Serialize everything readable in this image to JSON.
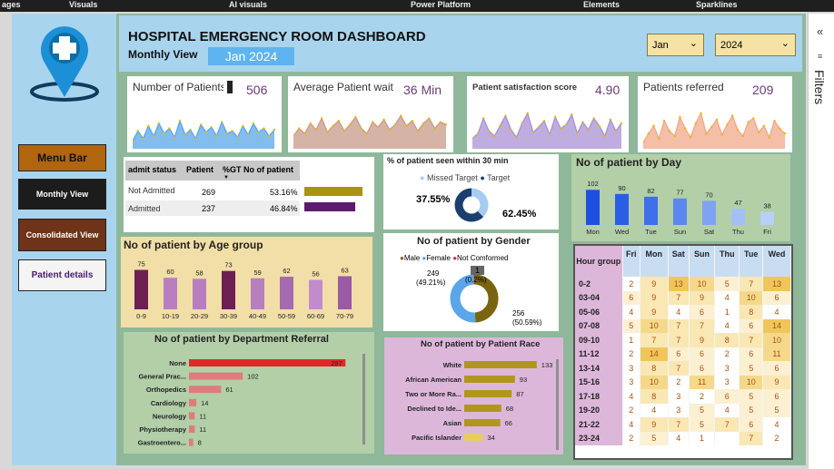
{
  "ribbon": {
    "items": [
      "ages",
      "Visuals",
      "AI visuals",
      "Power Platform",
      "Elements",
      "Sparklines"
    ]
  },
  "header": {
    "title": "HOSPITAL EMERGENCY ROOM DASHBOARD",
    "subtitle": "Monthly View",
    "period": "Jan 2024",
    "month_select": "Jan",
    "year_select": "2024"
  },
  "menu": {
    "title": "Menu Bar",
    "monthly": "Monthly View",
    "consolidated": "Consolidated View",
    "details": "Patient details"
  },
  "kpis": [
    {
      "label": "Number of Patients",
      "value": "506",
      "color": "#5aa6e8"
    },
    {
      "label": "Average Patient wait",
      "value": "36 Min",
      "color": "#c89a8a"
    },
    {
      "label": "Patient satisfaction score",
      "value": "4.90",
      "color": "#a891d3"
    },
    {
      "label": "Patients referred",
      "value": "209",
      "color": "#f0a88a"
    }
  ],
  "admit": {
    "headers": [
      "admit status",
      "Patient",
      "%GT No of patient"
    ],
    "rows": [
      {
        "status": "Not Admitted",
        "patients": "269",
        "pct": "53.16%",
        "share": 0.5316,
        "color": "#a89313"
      },
      {
        "status": "Admitted",
        "patients": "237",
        "pct": "46.84%",
        "share": 0.4684,
        "color": "#5c1b6e"
      }
    ]
  },
  "seen30": {
    "title": "% of patient seen within 30 min",
    "legend": [
      "Missed Target",
      "Target"
    ],
    "missed": "37.55%",
    "target": "62.45%",
    "missed_share": 0.3755,
    "colors": [
      "#a6cdf0",
      "#1a3e6e"
    ]
  },
  "gender": {
    "title": "No of patient by Gender",
    "legend": [
      "Male",
      "Female",
      "Not Comformed"
    ],
    "colors": [
      "#7a6410",
      "#5aa6e8",
      "#e0245e"
    ],
    "male_label": "249",
    "male_pct": "(49.21%)",
    "female_label": "256",
    "female_pct": "(50.59%)",
    "nc_label": "1",
    "nc_pct": "(0.2%)",
    "male_share": 0.4921
  },
  "day_chart": {
    "title": "No of patient by Day",
    "categories": [
      "Mon",
      "Wed",
      "Tue",
      "Sun",
      "Sat",
      "Thu",
      "Fri"
    ],
    "values": [
      102,
      90,
      82,
      77,
      70,
      47,
      38
    ],
    "colors": [
      "#1f4fe0",
      "#2a5ee6",
      "#3d70ea",
      "#5b88ee",
      "#7ea3f2",
      "#a3c0f6",
      "#b8d0f8"
    ]
  },
  "age_chart": {
    "title": "No of patient by Age group",
    "categories": [
      "0-9",
      "10-19",
      "20-29",
      "30-39",
      "40-49",
      "50-59",
      "60-69",
      "70-79"
    ],
    "values": [
      75,
      60,
      58,
      73,
      59,
      62,
      56,
      63
    ],
    "colors": [
      "#6e1f52",
      "#b87fc0",
      "#b87fc0",
      "#6e1f52",
      "#b87fc0",
      "#a56bb0",
      "#c28ccc",
      "#9a5aa6"
    ]
  },
  "dept_chart": {
    "title": "No of patient by Department Referral",
    "categories": [
      "None",
      "General Prac...",
      "Orthopedics",
      "Cardiology",
      "Neurology",
      "Physiotherapy",
      "Gastroentero..."
    ],
    "values": [
      297,
      102,
      61,
      14,
      11,
      11,
      8
    ]
  },
  "race_chart": {
    "title": "No of patient by Patient Race",
    "categories": [
      "White",
      "African American",
      "Two or More Ra...",
      "Declined to Ide...",
      "Asian",
      "Pacific Islander"
    ],
    "values": [
      133,
      93,
      87,
      68,
      66,
      34
    ]
  },
  "hour_grid": {
    "corner": "Hour group",
    "days": [
      "Fri",
      "Mon",
      "Sat",
      "Sun",
      "Thu",
      "Tue",
      "Wed"
    ],
    "rows": [
      {
        "hour": "0-2",
        "vals": [
          2,
          9,
          13,
          10,
          5,
          7,
          13
        ]
      },
      {
        "hour": "03-04",
        "vals": [
          6,
          9,
          7,
          9,
          4,
          10,
          6
        ]
      },
      {
        "hour": "05-06",
        "vals": [
          4,
          9,
          4,
          6,
          1,
          8,
          4
        ]
      },
      {
        "hour": "07-08",
        "vals": [
          5,
          10,
          7,
          7,
          4,
          6,
          14
        ]
      },
      {
        "hour": "09-10",
        "vals": [
          1,
          7,
          7,
          9,
          8,
          7,
          10
        ]
      },
      {
        "hour": "11-12",
        "vals": [
          2,
          14,
          6,
          6,
          2,
          6,
          11
        ]
      },
      {
        "hour": "13-14",
        "vals": [
          3,
          8,
          7,
          6,
          3,
          5,
          6
        ]
      },
      {
        "hour": "15-16",
        "vals": [
          3,
          10,
          2,
          11,
          3,
          10,
          9
        ]
      },
      {
        "hour": "17-18",
        "vals": [
          4,
          8,
          3,
          2,
          6,
          5,
          6
        ]
      },
      {
        "hour": "19-20",
        "vals": [
          2,
          4,
          3,
          5,
          4,
          5,
          5
        ]
      },
      {
        "hour": "21-22",
        "vals": [
          4,
          9,
          7,
          5,
          7,
          6,
          4
        ]
      },
      {
        "hour": "23-24",
        "vals": [
          2,
          5,
          4,
          1,
          "",
          7,
          2
        ]
      }
    ]
  },
  "filters": {
    "label": "Filters"
  }
}
